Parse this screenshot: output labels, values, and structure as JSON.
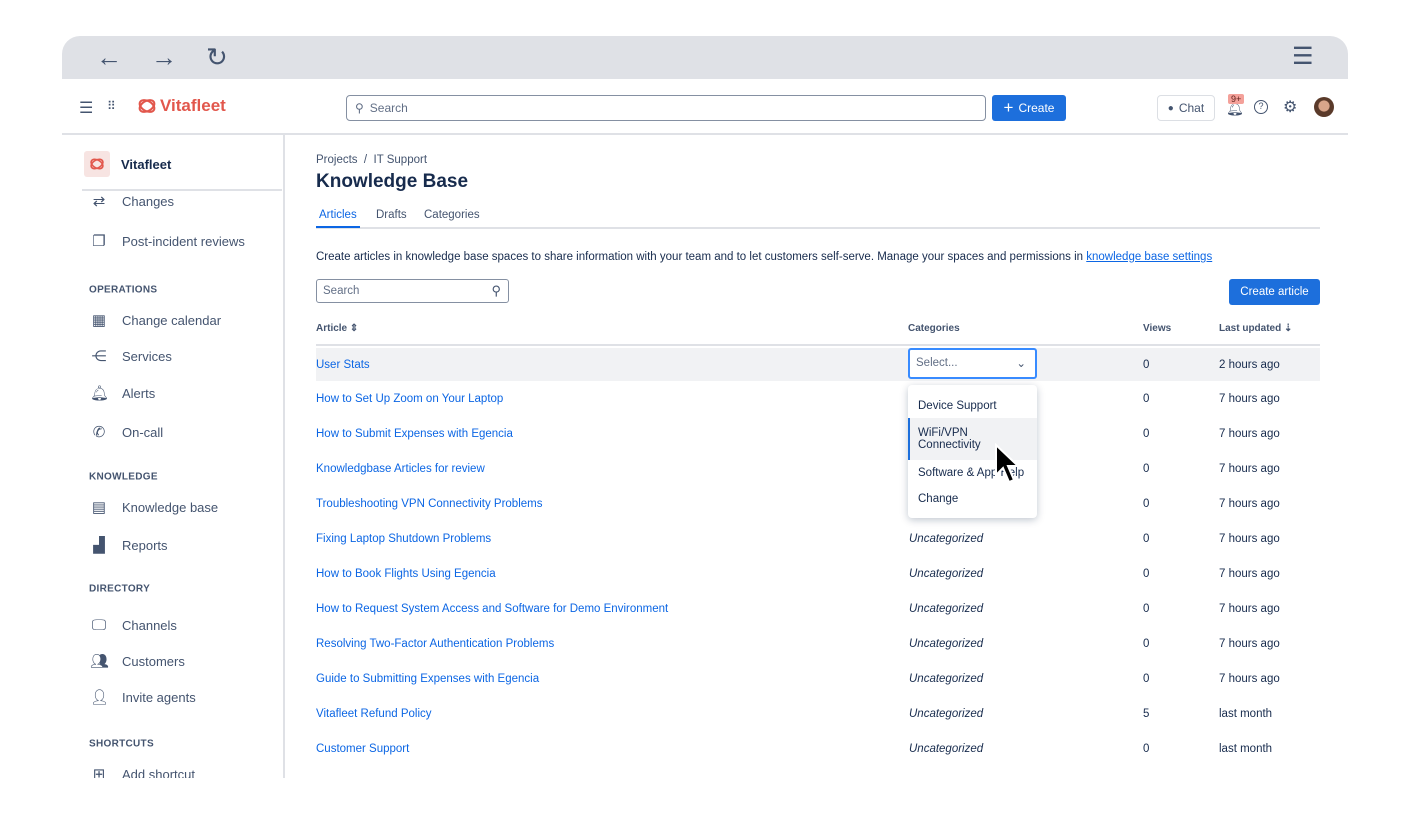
{
  "browser": {
    "back_icon": "←",
    "forward_icon": "→",
    "reload_icon": "↻",
    "menu_icon": "☰"
  },
  "topbar": {
    "brand": "Vitafleet",
    "search_placeholder": "Search",
    "create_label": "Create",
    "chat_label": "Chat",
    "notification_badge": "9+",
    "brand_color": "#e2574c",
    "accent": "#1d6fdc"
  },
  "sidebar": {
    "project": "Vitafleet",
    "items_top": [
      {
        "label": "Changes",
        "icon": "changes-icon"
      },
      {
        "label": "Post-incident reviews",
        "icon": "reviews-icon"
      }
    ],
    "sections": [
      {
        "title": "OPERATIONS",
        "items": [
          {
            "label": "Change calendar"
          },
          {
            "label": "Services"
          },
          {
            "label": "Alerts"
          },
          {
            "label": "On-call"
          }
        ]
      },
      {
        "title": "KNOWLEDGE",
        "items": [
          {
            "label": "Knowledge base"
          },
          {
            "label": "Reports"
          }
        ]
      },
      {
        "title": "DIRECTORY",
        "items": [
          {
            "label": "Channels"
          },
          {
            "label": "Customers"
          },
          {
            "label": "Invite agents"
          }
        ]
      },
      {
        "title": "SHORTCUTS",
        "items": [
          {
            "label": "Add shortcut"
          }
        ]
      }
    ]
  },
  "main": {
    "breadcrumb": [
      "Projects",
      "IT Support"
    ],
    "title": "Knowledge Base",
    "tabs": [
      "Articles",
      "Drafts",
      "Categories"
    ],
    "description": "Create articles in knowledge base spaces to share information with your team and to let customers self-serve. Manage your spaces and permissions in ",
    "settings_link": "knowledge base settings",
    "search_placeholder": "Search",
    "create_article": "Create article",
    "columns": [
      "Article",
      "Categories",
      "Views",
      "Last updated"
    ],
    "select_placeholder": "Select...",
    "dropdown_options": [
      "Device Support",
      "WiFi/VPN Connectivity",
      "Software & App Help",
      "Change"
    ],
    "rows": [
      {
        "title": "User Stats",
        "category": "",
        "views": "0",
        "updated": "2 hours ago"
      },
      {
        "title": "How to Set Up Zoom on Your Laptop",
        "category": "",
        "views": "0",
        "updated": "7 hours ago"
      },
      {
        "title": "How to Submit Expenses with Egencia",
        "category": "",
        "views": "0",
        "updated": "7 hours ago"
      },
      {
        "title": "Knowledgbase Articles for review",
        "category": "",
        "views": "0",
        "updated": "7 hours ago"
      },
      {
        "title": "Troubleshooting VPN Connectivity Problems",
        "category": "",
        "views": "0",
        "updated": "7 hours ago"
      },
      {
        "title": "Fixing Laptop Shutdown Problems",
        "category": "Uncategorized",
        "views": "0",
        "updated": "7 hours ago"
      },
      {
        "title": "How to Book Flights Using Egencia",
        "category": "Uncategorized",
        "views": "0",
        "updated": "7 hours ago"
      },
      {
        "title": "How to Request System Access and Software for Demo Environment",
        "category": "Uncategorized",
        "views": "0",
        "updated": "7 hours ago"
      },
      {
        "title": "Resolving Two-Factor Authentication Problems",
        "category": "Uncategorized",
        "views": "0",
        "updated": "7 hours ago"
      },
      {
        "title": "Guide to Submitting Expenses with Egencia",
        "category": "Uncategorized",
        "views": "0",
        "updated": "7 hours ago"
      },
      {
        "title": "Vitafleet Refund Policy",
        "category": "Uncategorized",
        "views": "5",
        "updated": "last month"
      },
      {
        "title": "Customer Support",
        "category": "Uncategorized",
        "views": "0",
        "updated": "last month"
      }
    ]
  }
}
